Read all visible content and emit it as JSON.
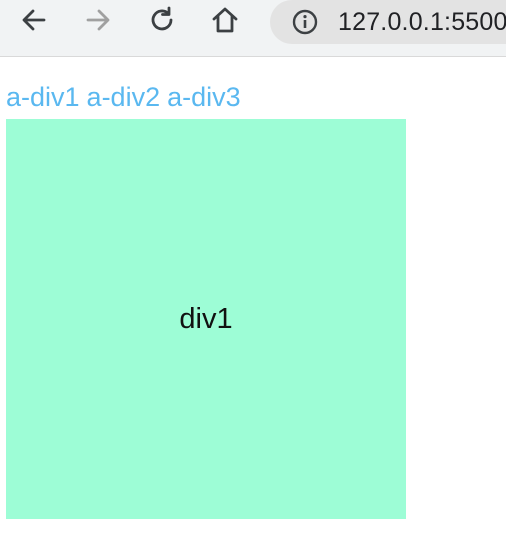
{
  "browser": {
    "url": "127.0.0.1:5500",
    "buttons": {
      "back": "arrow-left-icon",
      "forward": "arrow-right-icon",
      "reload": "reload-icon",
      "home": "home-icon",
      "info": "info-icon"
    }
  },
  "page": {
    "links": [
      {
        "label": "a-div1"
      },
      {
        "label": "a-div2"
      },
      {
        "label": "a-div3"
      }
    ],
    "panel": {
      "label": "div1",
      "color": "#9dfdd6"
    },
    "link_color": "#5ab8f0"
  }
}
